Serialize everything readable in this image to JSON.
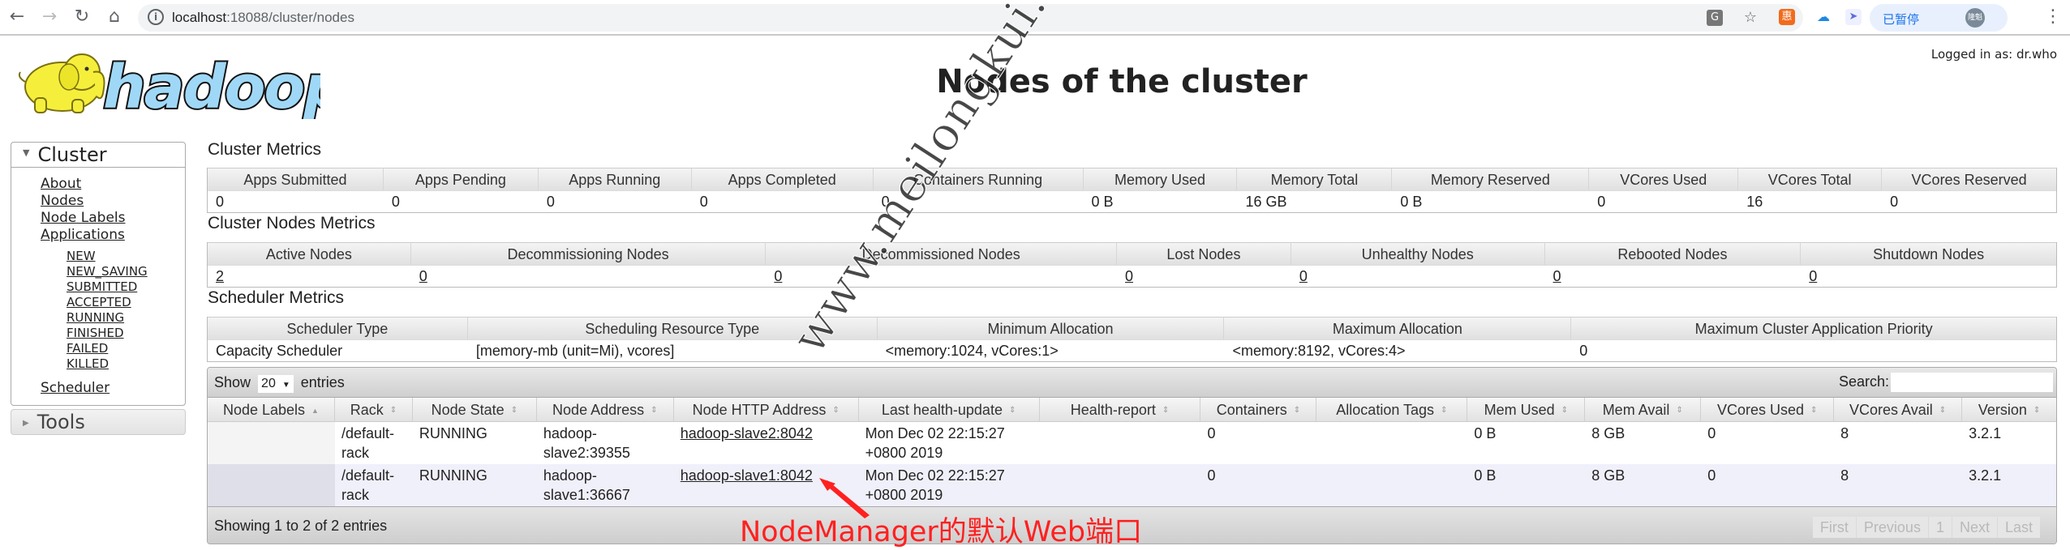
{
  "browser": {
    "url_host": "localhost",
    "url_path": ":18088/cluster/nodes",
    "profile_label": "已暂停",
    "profile_avatar": "隆魁"
  },
  "header": {
    "logo_text": "hadoop",
    "title": "Nodes of the cluster",
    "logged_in": "Logged in as: dr.who"
  },
  "sidebar": {
    "cluster_label": "Cluster",
    "links": [
      "About",
      "Nodes",
      "Node Labels",
      "Applications"
    ],
    "app_states": [
      "NEW",
      "NEW_SAVING",
      "SUBMITTED",
      "ACCEPTED",
      "RUNNING",
      "FINISHED",
      "FAILED",
      "KILLED"
    ],
    "scheduler_label": "Scheduler",
    "tools_label": "Tools"
  },
  "cluster_metrics": {
    "heading": "Cluster Metrics",
    "headers": [
      "Apps Submitted",
      "Apps Pending",
      "Apps Running",
      "Apps Completed",
      "Containers Running",
      "Memory Used",
      "Memory Total",
      "Memory Reserved",
      "VCores Used",
      "VCores Total",
      "VCores Reserved"
    ],
    "values": [
      "0",
      "0",
      "0",
      "0",
      "0",
      "0 B",
      "16 GB",
      "0 B",
      "0",
      "16",
      "0"
    ]
  },
  "nodes_metrics": {
    "heading": "Cluster Nodes Metrics",
    "headers": [
      "Active Nodes",
      "Decommissioning Nodes",
      "Decommissioned Nodes",
      "Lost Nodes",
      "Unhealthy Nodes",
      "Rebooted Nodes",
      "Shutdown Nodes"
    ],
    "values": [
      "2",
      "0",
      "0",
      "0",
      "0",
      "0",
      "0"
    ]
  },
  "scheduler_metrics": {
    "heading": "Scheduler Metrics",
    "headers": [
      "Scheduler Type",
      "Scheduling Resource Type",
      "Minimum Allocation",
      "Maximum Allocation",
      "Maximum Cluster Application Priority"
    ],
    "values": [
      "Capacity Scheduler",
      "[memory-mb (unit=Mi), vcores]",
      "<memory:1024, vCores:1>",
      "<memory:8192, vCores:4>",
      "0"
    ]
  },
  "nodes_table": {
    "show_label": "Show",
    "entries_label": "entries",
    "page_size": "20",
    "search_label": "Search:",
    "search_value": "",
    "columns": [
      "Node Labels",
      "Rack",
      "Node State",
      "Node Address",
      "Node HTTP Address",
      "Last health-update",
      "Health-report",
      "Containers",
      "Allocation Tags",
      "Mem Used",
      "Mem Avail",
      "VCores Used",
      "VCores Avail",
      "Version"
    ],
    "rows": [
      {
        "node_labels": "",
        "rack": "/default-rack",
        "rack_l1": "/default-",
        "rack_l2": "rack",
        "state": "RUNNING",
        "address_l1": "hadoop-",
        "address_l2": "slave2:39355",
        "http_address": "hadoop-slave2:8042",
        "health_update_l1": "Mon Dec 02 22:15:27",
        "health_update_l2": "+0800 2019",
        "health_report": "",
        "containers": "0",
        "allocation_tags": "",
        "mem_used": "0 B",
        "mem_avail": "8 GB",
        "vcores_used": "0",
        "vcores_avail": "8",
        "version": "3.2.1"
      },
      {
        "node_labels": "",
        "rack_l1": "/default-",
        "rack_l2": "rack",
        "state": "RUNNING",
        "address_l1": "hadoop-",
        "address_l2": "slave1:36667",
        "http_address": "hadoop-slave1:8042",
        "health_update_l1": "Mon Dec 02 22:15:27",
        "health_update_l2": "+0800 2019",
        "health_report": "",
        "containers": "0",
        "allocation_tags": "",
        "mem_used": "0 B",
        "mem_avail": "8 GB",
        "vcores_used": "0",
        "vcores_avail": "8",
        "version": "3.2.1"
      }
    ],
    "info": "Showing 1 to 2 of 2 entries",
    "pagination": [
      "First",
      "Previous",
      "1",
      "Next",
      "Last"
    ]
  },
  "overlay": {
    "watermark": "www.meilongkui.com",
    "annotation": "NodeManager的默认Web端口",
    "annotation_color": "#ff2020"
  }
}
